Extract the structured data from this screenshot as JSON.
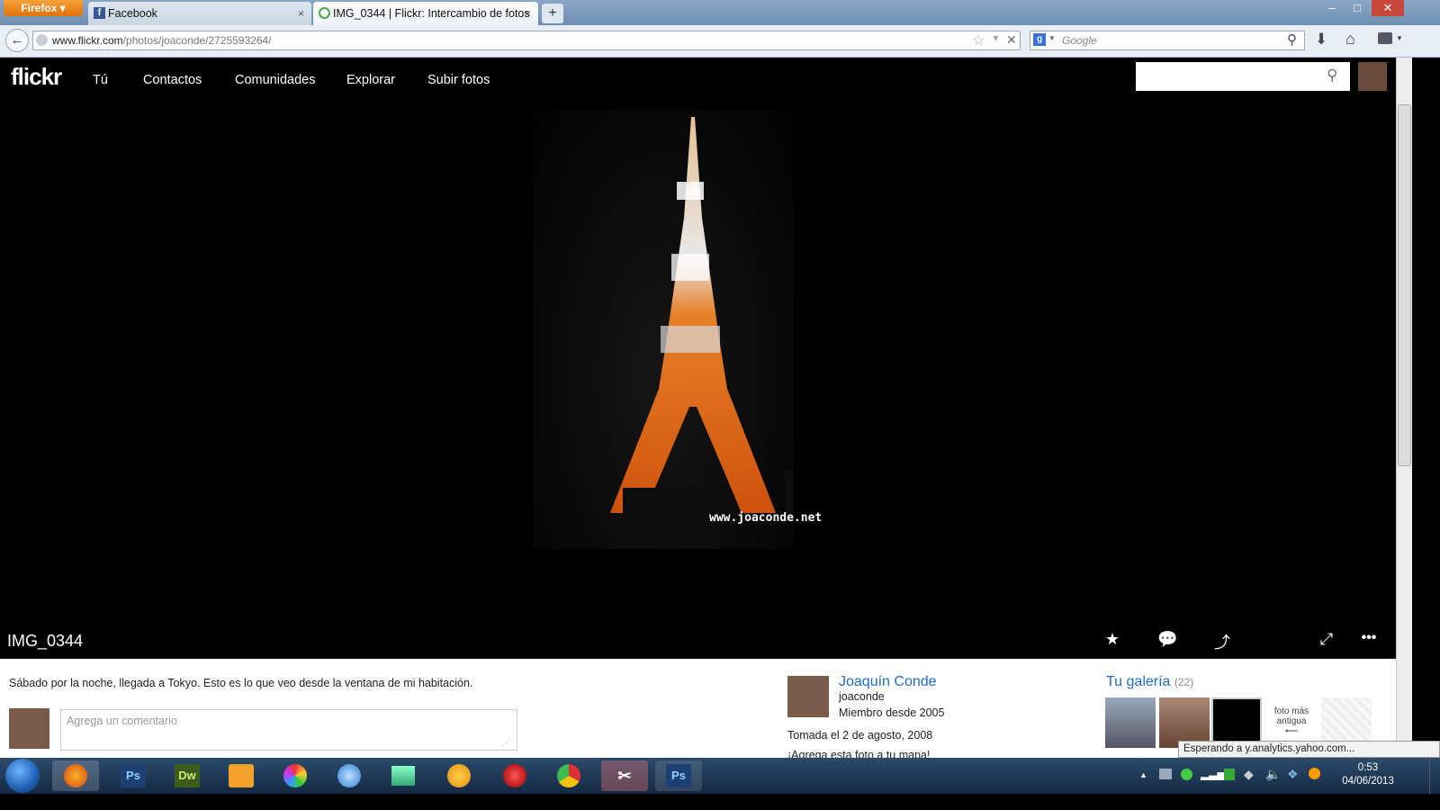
{
  "browser": {
    "menu_label": "Firefox",
    "tabs": [
      {
        "title": "Facebook",
        "close": "×"
      },
      {
        "title": "IMG_0344 | Flickr: Intercambio de fotos",
        "close": "×"
      }
    ],
    "new_tab": "+",
    "window_buttons": {
      "minimize": "‒",
      "maximize": "□",
      "close": "✕"
    },
    "url_host": "www.flickr.com",
    "url_path": "/photos/joaconde/2725593264/",
    "search_engine_placeholder": "Google"
  },
  "flickr": {
    "logo": "flickr",
    "nav": [
      "Tú",
      "Contactos",
      "Comunidades",
      "Explorar",
      "Subir fotos"
    ]
  },
  "photo": {
    "watermark": "www.joaconde.net",
    "title": "IMG_0344",
    "actions": {
      "favorite": "★",
      "comment": "💬",
      "share": "⤴",
      "fullscreen": "⤢",
      "more": "•••"
    }
  },
  "details": {
    "description": "Sábado por la noche, llegada a Tokyo. Esto es lo que veo desde la ventana de mi habitación.",
    "comment_placeholder": "Agrega un comentario",
    "owner_name": "Joaquín Conde",
    "owner_username": "joaconde",
    "member_since": "Miembro desde 2005",
    "taken": "Tomada el 2 de agosto, 2008",
    "add_map": "¡Agrega esta foto a tu mapa!",
    "gallery_title": "Tu galería",
    "gallery_count": "(22)",
    "oldest_label": "foto más antigua",
    "oldest_arrow": "⟵"
  },
  "status_bar": "Esperando a y.analytics.yahoo.com...",
  "taskbar": {
    "apps": [
      "",
      "Ps",
      "Dw",
      "",
      "",
      "",
      "",
      "",
      "",
      "",
      "",
      "Ps"
    ],
    "time": "0:53",
    "date": "04/06/2013"
  }
}
